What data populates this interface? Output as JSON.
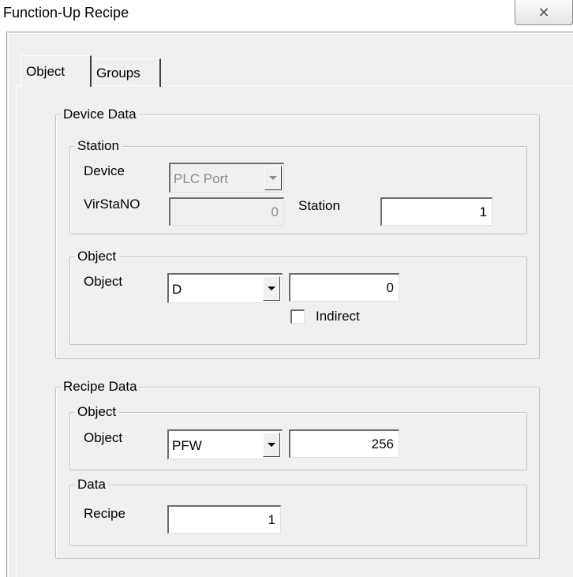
{
  "window": {
    "title": "Function-Up Recipe",
    "close_glyph": "✕"
  },
  "tabs": [
    {
      "label": "Object"
    },
    {
      "label": "Groups"
    }
  ],
  "device_data": {
    "label": "Device Data",
    "station_group": {
      "label": "Station",
      "device_label": "Device",
      "device_value": "PLC Port",
      "virstano_label": "VirStaNO",
      "virstano_value": "0",
      "station_label": "Station",
      "station_value": "1"
    },
    "object_group": {
      "label": "Object",
      "object_label": "Object",
      "object_type": "D",
      "object_address": "0",
      "indirect_label": "Indirect"
    }
  },
  "recipe_data": {
    "label": "Recipe Data",
    "object_group": {
      "label": "Object",
      "object_label": "Object",
      "object_type": "PFW",
      "object_address": "256"
    },
    "data_group": {
      "label": "Data",
      "recipe_label": "Recipe",
      "recipe_value": "1"
    }
  }
}
